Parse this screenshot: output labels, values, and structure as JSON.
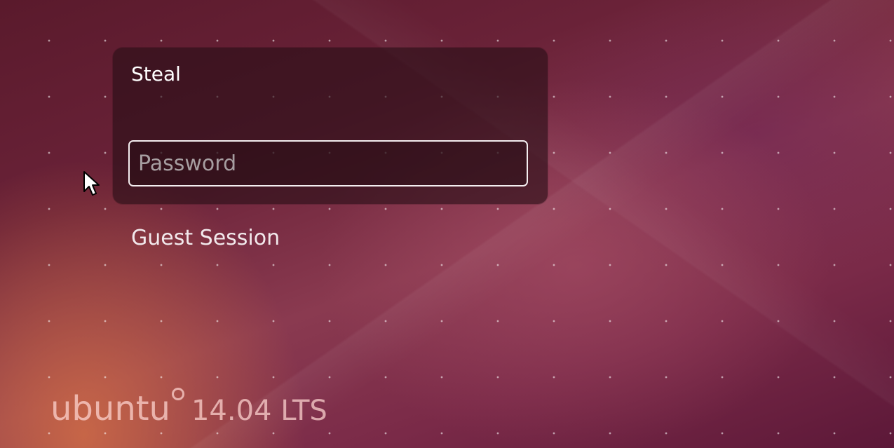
{
  "login": {
    "user_name": "Steal",
    "password_placeholder": "Password",
    "password_value": ""
  },
  "guest_session_label": "Guest Session",
  "branding": {
    "word": "ubuntu",
    "version": "14.04 LTS"
  },
  "icons": {
    "cursor": "mouse-pointer-icon",
    "brand_mark": "ubuntu-circle-of-friends-icon"
  },
  "colors": {
    "background_dark": "#5a1a2c",
    "background_warm": "#d26e46",
    "panel": "#280e16",
    "text": "#ffffff"
  }
}
